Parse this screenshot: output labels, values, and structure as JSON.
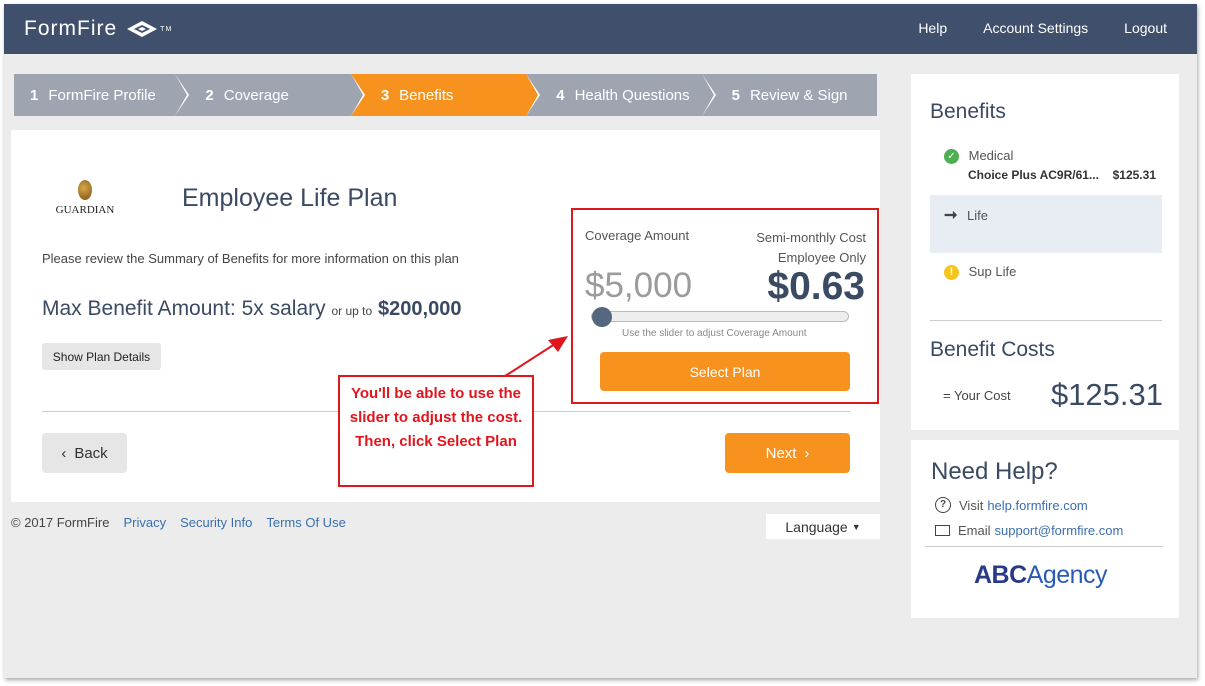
{
  "header": {
    "logo_text": "FormFire",
    "nav": [
      "Help",
      "Account Settings",
      "Logout"
    ]
  },
  "steps": [
    {
      "num": "1",
      "label": "FormFire Profile",
      "active": false
    },
    {
      "num": "2",
      "label": "Coverage",
      "active": false
    },
    {
      "num": "3",
      "label": "Benefits",
      "active": true
    },
    {
      "num": "4",
      "label": "Health Questions",
      "active": false
    },
    {
      "num": "5",
      "label": "Review & Sign",
      "active": false
    }
  ],
  "plan": {
    "carrier": "GUARDIAN",
    "title": "Employee Life Plan",
    "review_text": "Please review the Summary of Benefits for more information on this plan",
    "max_benefit_label": "Max Benefit Amount: 5x salary",
    "max_benefit_connector": "or up to",
    "max_benefit_amount": "$200,000",
    "details_button": "Show Plan Details",
    "back_button": "Back",
    "next_button": "Next"
  },
  "selector": {
    "coverage_label": "Coverage Amount",
    "cost_label_1": "Semi-monthly Cost",
    "cost_label_2": "Employee Only",
    "coverage_amount": "$5,000",
    "cost_amount": "$0.63",
    "slider_hint": "Use the slider to adjust Coverage Amount",
    "slider_level": 0,
    "select_button": "Select Plan"
  },
  "callout": {
    "text": "You'll be able to use the slider to adjust the cost. Then, click Select Plan"
  },
  "footer": {
    "copyright": "© 2017 FormFire",
    "links": [
      "Privacy",
      "Security Info",
      "Terms Of Use"
    ],
    "language": "Language"
  },
  "sidebar": {
    "title": "Benefits",
    "items": [
      {
        "label": "Medical",
        "status": "complete",
        "plan": "Choice Plus AC9R/61...",
        "cost": "$125.31"
      },
      {
        "label": "Life",
        "status": "current"
      },
      {
        "label": "Sup Life",
        "status": "pending"
      }
    ],
    "costs_title": "Benefit Costs",
    "your_cost_label": "= Your Cost",
    "your_cost_value": "$125.31"
  },
  "help": {
    "title": "Need Help?",
    "visit_label": "Visit",
    "visit_link": "help.formfire.com",
    "email_label": "Email",
    "email_link": "support@formfire.com",
    "agency_bold": "ABC",
    "agency_light": "Agency"
  },
  "colors": {
    "header_bg": "#404f6b",
    "accent_orange": "#f7921e",
    "step_grey": "#9ea5b1",
    "annotation_red": "#e0161d"
  }
}
